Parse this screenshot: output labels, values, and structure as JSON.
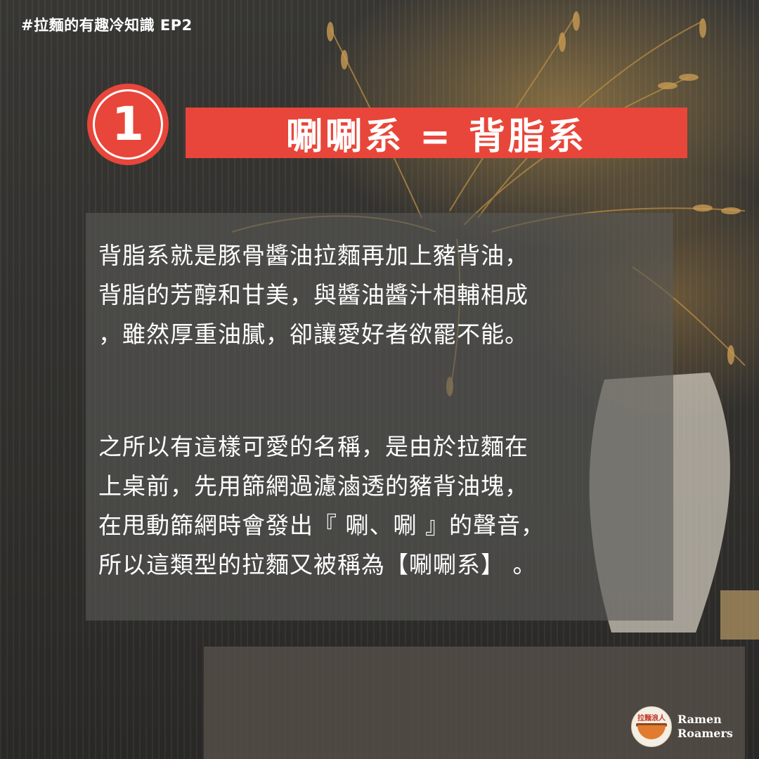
{
  "header": {
    "hashtag": "#拉麵的有趣冷知識  EP2"
  },
  "badge": {
    "number": "1",
    "color": "#e8463a"
  },
  "title": {
    "text": "唰唰系 = 背脂系",
    "bar_color": "#e8463a"
  },
  "body": {
    "paragraph1": [
      "背脂系就是豚骨醬油拉麵再加上豬背油，",
      "背脂的芳醇和甘美，與醬油醬汁相輔相成",
      "，雖然厚重油膩，卻讓愛好者欲罷不能。"
    ],
    "paragraph2": [
      "之所以有這樣可愛的名稱，是由於拉麵在",
      "上桌前，先用篩網過濾滷透的豬背油塊，",
      "在甩動篩網時會發出『 唰、唰 』的聲音，",
      "所以這類型的拉麵又被稱為【唰唰系】 。"
    ]
  },
  "logo": {
    "mark_text": "拉麵浪人",
    "line1": "Ramen",
    "line2": "Roamers"
  }
}
